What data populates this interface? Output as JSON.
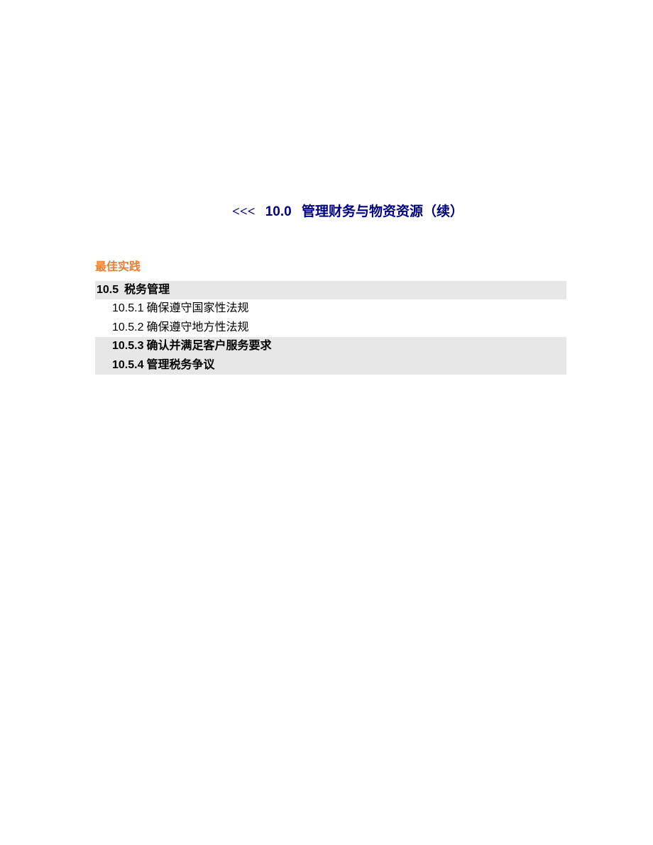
{
  "title": {
    "prefix": "<<<",
    "number": "10.0",
    "text": "管理财务与物资资源（续）"
  },
  "bestPracticeLabel": "最佳实践",
  "section": {
    "number": "10.5",
    "title": "税务管理",
    "items": [
      {
        "number": "10.5.1",
        "text": "确保遵守国家性法规",
        "bold": false
      },
      {
        "number": "10.5.2",
        "text": "确保遵守地方性法规",
        "bold": false
      },
      {
        "number": "10.5.3",
        "text": "确认并满足客户服务要求",
        "bold": true
      },
      {
        "number": "10.5.4",
        "text": "管理税务争议",
        "bold": true
      }
    ]
  }
}
